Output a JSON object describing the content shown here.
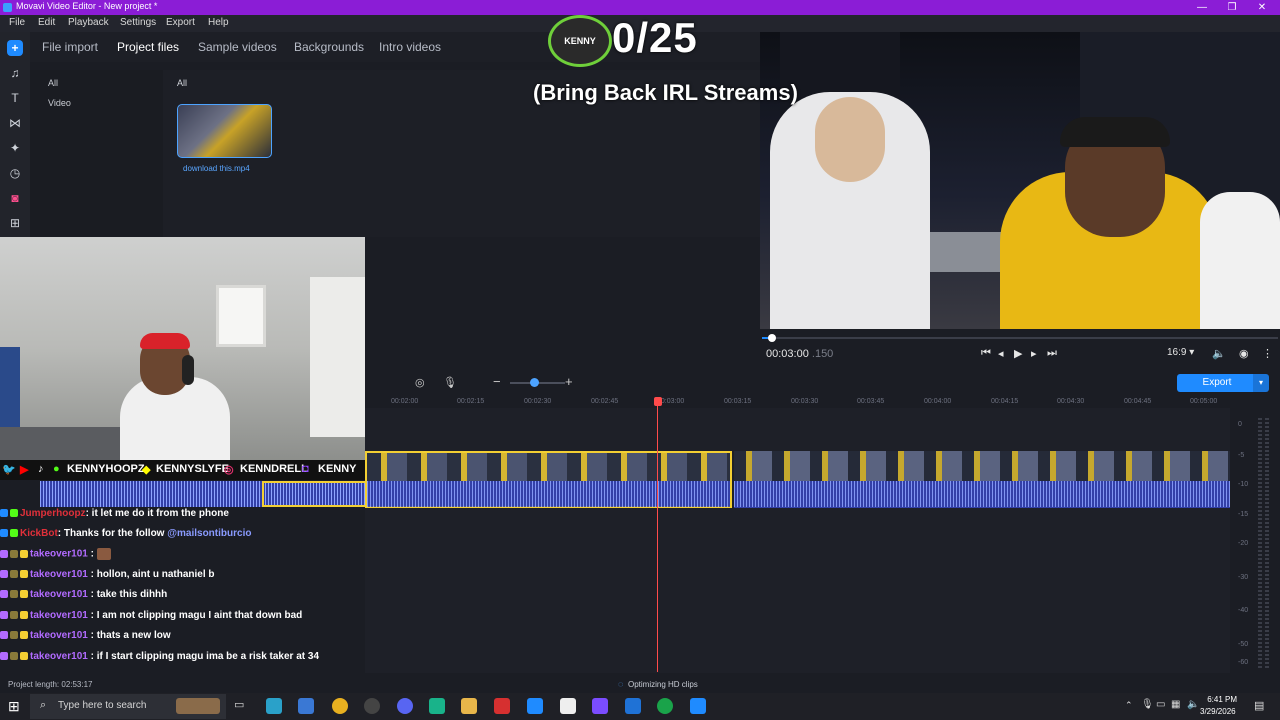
{
  "window": {
    "title": "Movavi Video Editor - New project *",
    "controls": [
      "—",
      "❐",
      "✕"
    ]
  },
  "menu": [
    "File",
    "Edit",
    "Playback",
    "Settings",
    "Export",
    "Help"
  ],
  "rail_icons": [
    "plus-icon",
    "music-icon",
    "text-icon",
    "transitions-icon",
    "filters-icon",
    "clock-icon",
    "stickers-icon",
    "more-tools-icon"
  ],
  "media_tabs": [
    {
      "label": "File import",
      "active": false
    },
    {
      "label": "Project files",
      "active": true
    },
    {
      "label": "Sample videos",
      "active": false
    },
    {
      "label": "Backgrounds",
      "active": false
    },
    {
      "label": "Intro videos",
      "active": false
    }
  ],
  "folders": [
    "All",
    "Video"
  ],
  "media_header": "All",
  "media_file": {
    "name": "download this.mp4"
  },
  "overlay": {
    "count": "0/25",
    "subtitle": "(Bring Back IRL Streams)",
    "logo_text": "KENNY"
  },
  "player": {
    "timecode": "00:03:00",
    "frames": ".150",
    "aspect": "16:9 ▾",
    "progress": 0.02
  },
  "timeline": {
    "export_label": "Export",
    "ruler": [
      "00:02:00",
      "00:02:15",
      "00:02:30",
      "00:02:45",
      "00:03:00",
      "00:03:15",
      "00:03:30",
      "00:03:45",
      "00:04:00",
      "00:04:15",
      "00:04:30",
      "00:04:45",
      "00:05:00"
    ],
    "vu_labels": [
      "0",
      "-5",
      "-10",
      "-15",
      "-20",
      "-30",
      "-40",
      "-50",
      "-60"
    ]
  },
  "social": [
    "KENNYHOOPZ",
    "KENNYSLYFE",
    "KENNDRELL",
    "KENNY"
  ],
  "chat": [
    {
      "user": "Jumperhoopz",
      "color": "#e0303a",
      "message": ": it let me do it from the phone",
      "mention": ""
    },
    {
      "user": "KickBot",
      "color": "#e0303a",
      "message": ": Thanks for the follow ",
      "mention": "@mailsontiburcio"
    },
    {
      "user": "takeover101",
      "color": "#b26bff",
      "message": " : ",
      "mention": ""
    },
    {
      "user": "takeover101",
      "color": "#b26bff",
      "message": " : hollon, aint u nathaniel b",
      "mention": ""
    },
    {
      "user": "takeover101",
      "color": "#b26bff",
      "message": " : take this dihhh",
      "mention": ""
    },
    {
      "user": "takeover101",
      "color": "#b26bff",
      "message": " : I am not clipping magu I aint that down bad",
      "mention": ""
    },
    {
      "user": "takeover101",
      "color": "#b26bff",
      "message": " : thats a new low",
      "mention": ""
    },
    {
      "user": "takeover101",
      "color": "#b26bff",
      "message": " : if I start clipping magu ima be a risk taker at 34",
      "mention": ""
    }
  ],
  "status": {
    "project_length": "Project length: 02:53:17",
    "optimizing": "Optimizing HD clips"
  },
  "taskbar": {
    "search_placeholder": "Type here to search",
    "time": "6:41 PM",
    "date": "3/29/2026"
  }
}
